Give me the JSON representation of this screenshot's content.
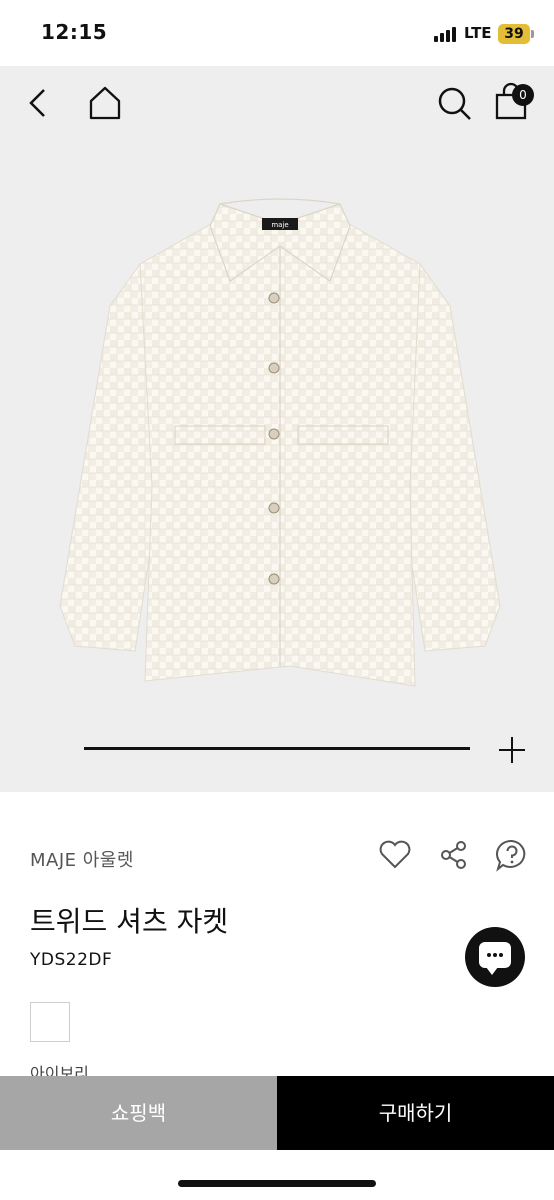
{
  "status": {
    "time": "12:15",
    "network": "LTE",
    "battery": "39"
  },
  "header": {
    "cart_count": "0"
  },
  "product": {
    "brand": "MAJE 아울렛",
    "name": "트위드 셔츠 자켓",
    "code": "YDS22DF",
    "color_name": "아이보리",
    "swatch_color": "#ffffff",
    "jacket_label": "maje"
  },
  "icons": {
    "back": "back-arrow-icon",
    "home": "home-icon",
    "search": "search-icon",
    "cart": "shopping-bag-icon",
    "zoom": "plus-icon",
    "like": "heart-icon",
    "share": "share-icon",
    "qna": "question-bubble-icon",
    "chat": "chat-icon"
  },
  "gallery": {
    "progress": 0.94
  },
  "buttons": {
    "cart": "쇼핑백",
    "buy": "구매하기"
  },
  "colors": {
    "cart_button": "#a6a6a6",
    "buy_button": "#000000",
    "hero_background": "#eeeeee"
  }
}
